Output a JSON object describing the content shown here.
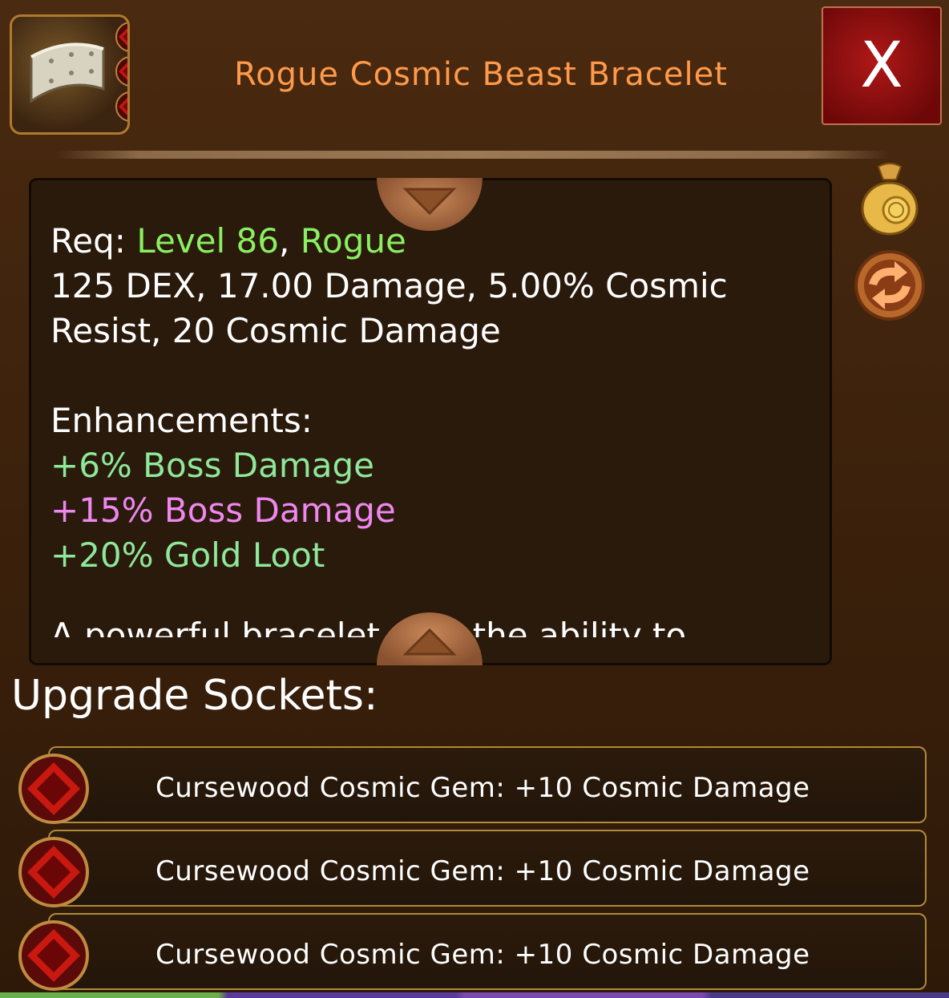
{
  "header": {
    "item_title": "Rogue Cosmic Beast Bracelet",
    "close_label": "X",
    "icon": "bracelet-icon",
    "enhancement_dot_colors": [
      "#7ee08a",
      "#e07ae0",
      "#7ee08a"
    ],
    "title_color": "#ff9a4a"
  },
  "stats": {
    "req_label": "Req:",
    "req_level": "Level 86",
    "req_sep": ",",
    "req_class": "Rogue",
    "line_2": "125 DEX, 17.00 Damage, 5.00% Cosmic",
    "line_3": "Resist, 20 Cosmic Damage",
    "enhancements_heading": "Enhancements:",
    "enhancement_1": "+6% Boss Damage",
    "enhancement_2": "+15% Boss Damage",
    "enhancement_3": "+20% Gold Loot",
    "cutoff_line": "A powerful bracelet with the ability to"
  },
  "side_buttons": {
    "loot_icon": "loot-bag-icon",
    "swap_icon": "swap-arrows-icon"
  },
  "sockets": {
    "heading": "Upgrade Sockets:",
    "items": [
      {
        "label": "Cursewood Cosmic Gem: +10 Cosmic Damage",
        "icon": "red-gem-icon"
      },
      {
        "label": "Cursewood Cosmic Gem: +10 Cosmic Damage",
        "icon": "red-gem-icon"
      },
      {
        "label": "Cursewood Cosmic Gem: +10 Cosmic Damage",
        "icon": "red-gem-icon"
      }
    ]
  }
}
